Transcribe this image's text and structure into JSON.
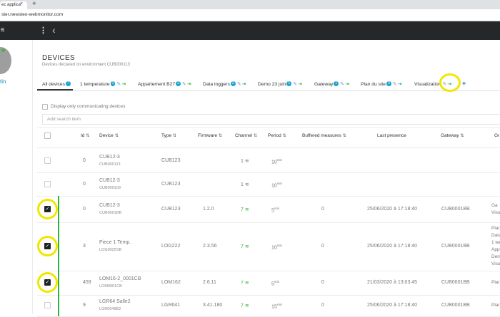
{
  "browser": {
    "tab_title": "ec applica",
    "url": "ster.newsteo-webmonitor.com",
    "close": "×",
    "new_tab": "+"
  },
  "header": {
    "menu_icon": "⋮",
    "back_icon": "‹"
  },
  "sidebar": {
    "user_name": "tin"
  },
  "page": {
    "title": "DEVICES",
    "subtitle": "Devices declared on environment CUB000113"
  },
  "tabs": [
    {
      "label": "All devices",
      "badge": "7"
    },
    {
      "label": "1 temperature",
      "badge": "1"
    },
    {
      "label": "Appartement B27",
      "badge": "2"
    },
    {
      "label": "Data loggers",
      "badge": "2"
    },
    {
      "label": "Demo 23 juin",
      "badge": "1"
    },
    {
      "label": "Gateway",
      "badge": "1"
    },
    {
      "label": "Plan du site",
      "badge": "3"
    },
    {
      "label": "Visualization",
      "badge": ""
    }
  ],
  "filter": {
    "only_communicating": "Display only communicating devices",
    "search_placeholder": "Add search item"
  },
  "columns": {
    "id": "Id",
    "device": "Device",
    "type": "Type",
    "firmware": "Firmware",
    "channel": "Channel",
    "period": "Period",
    "buffered": "Buffered measures",
    "last_presence": "Last presence",
    "gateway": "Gateway",
    "groups": "Gr"
  },
  "rows": [
    {
      "id": "0",
      "name": "CUB12-3",
      "serial": "CUB000113",
      "type": "CUB123",
      "firmware": "",
      "channel": "1",
      "period": "10",
      "period_unit": "min",
      "buffered": "",
      "last": "",
      "gateway": "",
      "groups": "",
      "checked": false,
      "active": false
    },
    {
      "id": "0",
      "name": "CUB12-3",
      "serial": "CUB000109",
      "type": "CUB123",
      "firmware": "",
      "channel": "1",
      "period": "10",
      "period_unit": "min",
      "buffered": "",
      "last": "",
      "gateway": "",
      "groups": "",
      "checked": false,
      "active": false
    },
    {
      "id": "0",
      "name": "CUB12-3",
      "serial": "CUB0001BB",
      "type": "CUB123",
      "firmware": "1.2.0",
      "channel": "7",
      "period": "5",
      "period_unit": "min",
      "buffered": "0",
      "last": "25/06/2020 à 17:18:40",
      "gateway": "CUB0001BB",
      "groups": "Ga\nVisu",
      "checked": true,
      "active": true
    },
    {
      "id": "3",
      "name": "Piece 1 Temp.",
      "serial": "LOG0025SB",
      "type": "LOG222",
      "firmware": "2.3.56",
      "channel": "7",
      "period": "10",
      "period_unit": "min",
      "buffered": "0",
      "last": "25/06/2020 à 17:18:40",
      "gateway": "CUB0001BB",
      "groups": "Plar\nData\n1 tem\nAppart\nDem\nVisua",
      "checked": true,
      "active": true
    },
    {
      "id": "459",
      "name": "LOM16-2_0001CB",
      "serial": "LOM0001CB",
      "type": "LOM162",
      "firmware": "2.6.11",
      "channel": "7",
      "period": "5",
      "period_unit": "min",
      "buffered": "0",
      "last": "21/03/2020 à 13:03:45",
      "gateway": "CUB0001BB",
      "groups": "Plar",
      "checked": true,
      "active": true
    },
    {
      "id": "9",
      "name": "LGR64 Salle2",
      "serial": "LGR0049B2",
      "type": "LGR641",
      "firmware": "3.41.180",
      "channel": "7",
      "period": "15",
      "period_unit": "min",
      "buffered": "0",
      "last": "25/06/2020 à 17:18:40",
      "gateway": "CUB0001BB",
      "groups": "Plar",
      "checked": false,
      "active": true
    }
  ],
  "colors": {
    "accent": "#1ba3d2",
    "green": "#2db24a",
    "highlight": "#f2e600",
    "header_bg": "#262728"
  }
}
